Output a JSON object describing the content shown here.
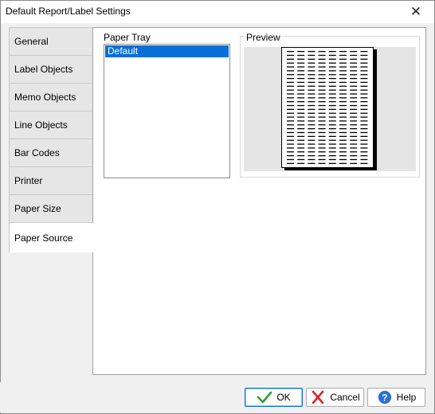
{
  "window": {
    "title": "Default Report/Label Settings",
    "close_glyph": "✕"
  },
  "tabs": [
    {
      "label": "General"
    },
    {
      "label": "Label Objects"
    },
    {
      "label": "Memo Objects"
    },
    {
      "label": "Line Objects"
    },
    {
      "label": "Bar Codes"
    },
    {
      "label": "Printer"
    },
    {
      "label": "Paper Size"
    },
    {
      "label": "Paper Source",
      "active": true
    }
  ],
  "paper_source": {
    "tray_label": "Paper Tray",
    "tray_items": [
      "Default"
    ],
    "selected_tray": "Default",
    "preview_label": "Preview"
  },
  "buttons": {
    "ok": "OK",
    "cancel": "Cancel",
    "help": "Help"
  },
  "icons": {
    "ok": "check-icon",
    "cancel": "x-icon",
    "help": "help-icon",
    "close": "close-icon"
  },
  "colors": {
    "selection": "#0a6fd6",
    "ok_icon": "#2e9e3a",
    "cancel_icon": "#d9262b",
    "help_icon": "#2b6fd6"
  }
}
